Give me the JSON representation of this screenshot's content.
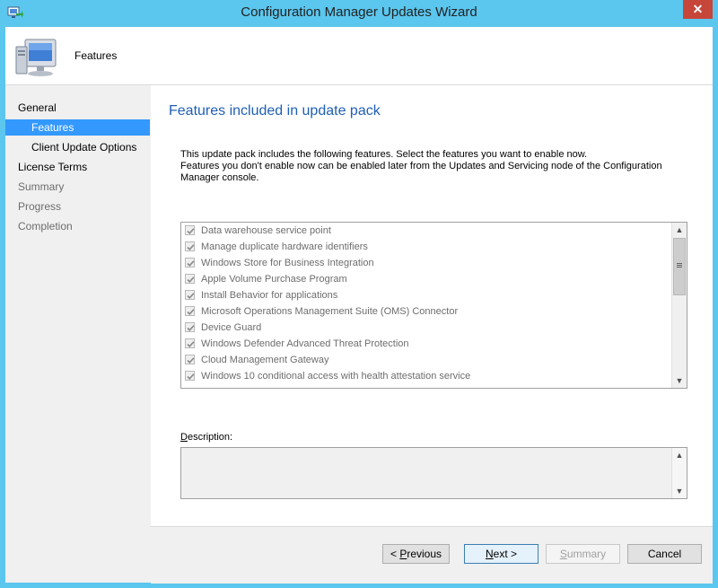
{
  "window": {
    "title": "Configuration Manager Updates Wizard",
    "close_label": "✕"
  },
  "header": {
    "title": "Features"
  },
  "nav": {
    "items": [
      {
        "label": "General",
        "state": "normal",
        "level": 0
      },
      {
        "label": "Features",
        "state": "active",
        "level": 1
      },
      {
        "label": "Client Update Options",
        "state": "normal",
        "level": 1
      },
      {
        "label": "License Terms",
        "state": "normal",
        "level": 0
      },
      {
        "label": "Summary",
        "state": "disabled",
        "level": 0
      },
      {
        "label": "Progress",
        "state": "disabled",
        "level": 0
      },
      {
        "label": "Completion",
        "state": "disabled",
        "level": 0
      }
    ]
  },
  "main": {
    "title": "Features included in update pack",
    "intro_line1": "This update pack includes the following features. Select the features you want to enable now.",
    "intro_line2": "Features you don't enable now can be enabled later from the Updates and Servicing node of the Configuration Manager console.",
    "features": [
      {
        "label": "Data warehouse service point",
        "checked": true
      },
      {
        "label": "Manage duplicate hardware identifiers",
        "checked": true
      },
      {
        "label": "Windows Store for Business Integration",
        "checked": true
      },
      {
        "label": "Apple Volume Purchase Program",
        "checked": true
      },
      {
        "label": "Install Behavior for applications",
        "checked": true
      },
      {
        "label": "Microsoft Operations Management Suite (OMS) Connector",
        "checked": true
      },
      {
        "label": "Device Guard",
        "checked": true
      },
      {
        "label": "Windows Defender Advanced Threat Protection",
        "checked": true
      },
      {
        "label": "Cloud Management Gateway",
        "checked": true
      },
      {
        "label": "Windows 10 conditional access with health attestation service",
        "checked": true
      }
    ],
    "description_label_prefix": "",
    "description_label_key": "D",
    "description_label_rest": "escription:",
    "description_text": ""
  },
  "footer": {
    "previous_key": "P",
    "previous_rest": "revious",
    "next_key": "N",
    "next_rest": "ext >",
    "summary_key": "S",
    "summary_rest": "ummary",
    "cancel_label": "Cancel"
  },
  "colors": {
    "window_frame": "#5bc6ee",
    "active_nav": "#3399ff",
    "page_title": "#1f5fb5",
    "close_button": "#c7463a"
  }
}
